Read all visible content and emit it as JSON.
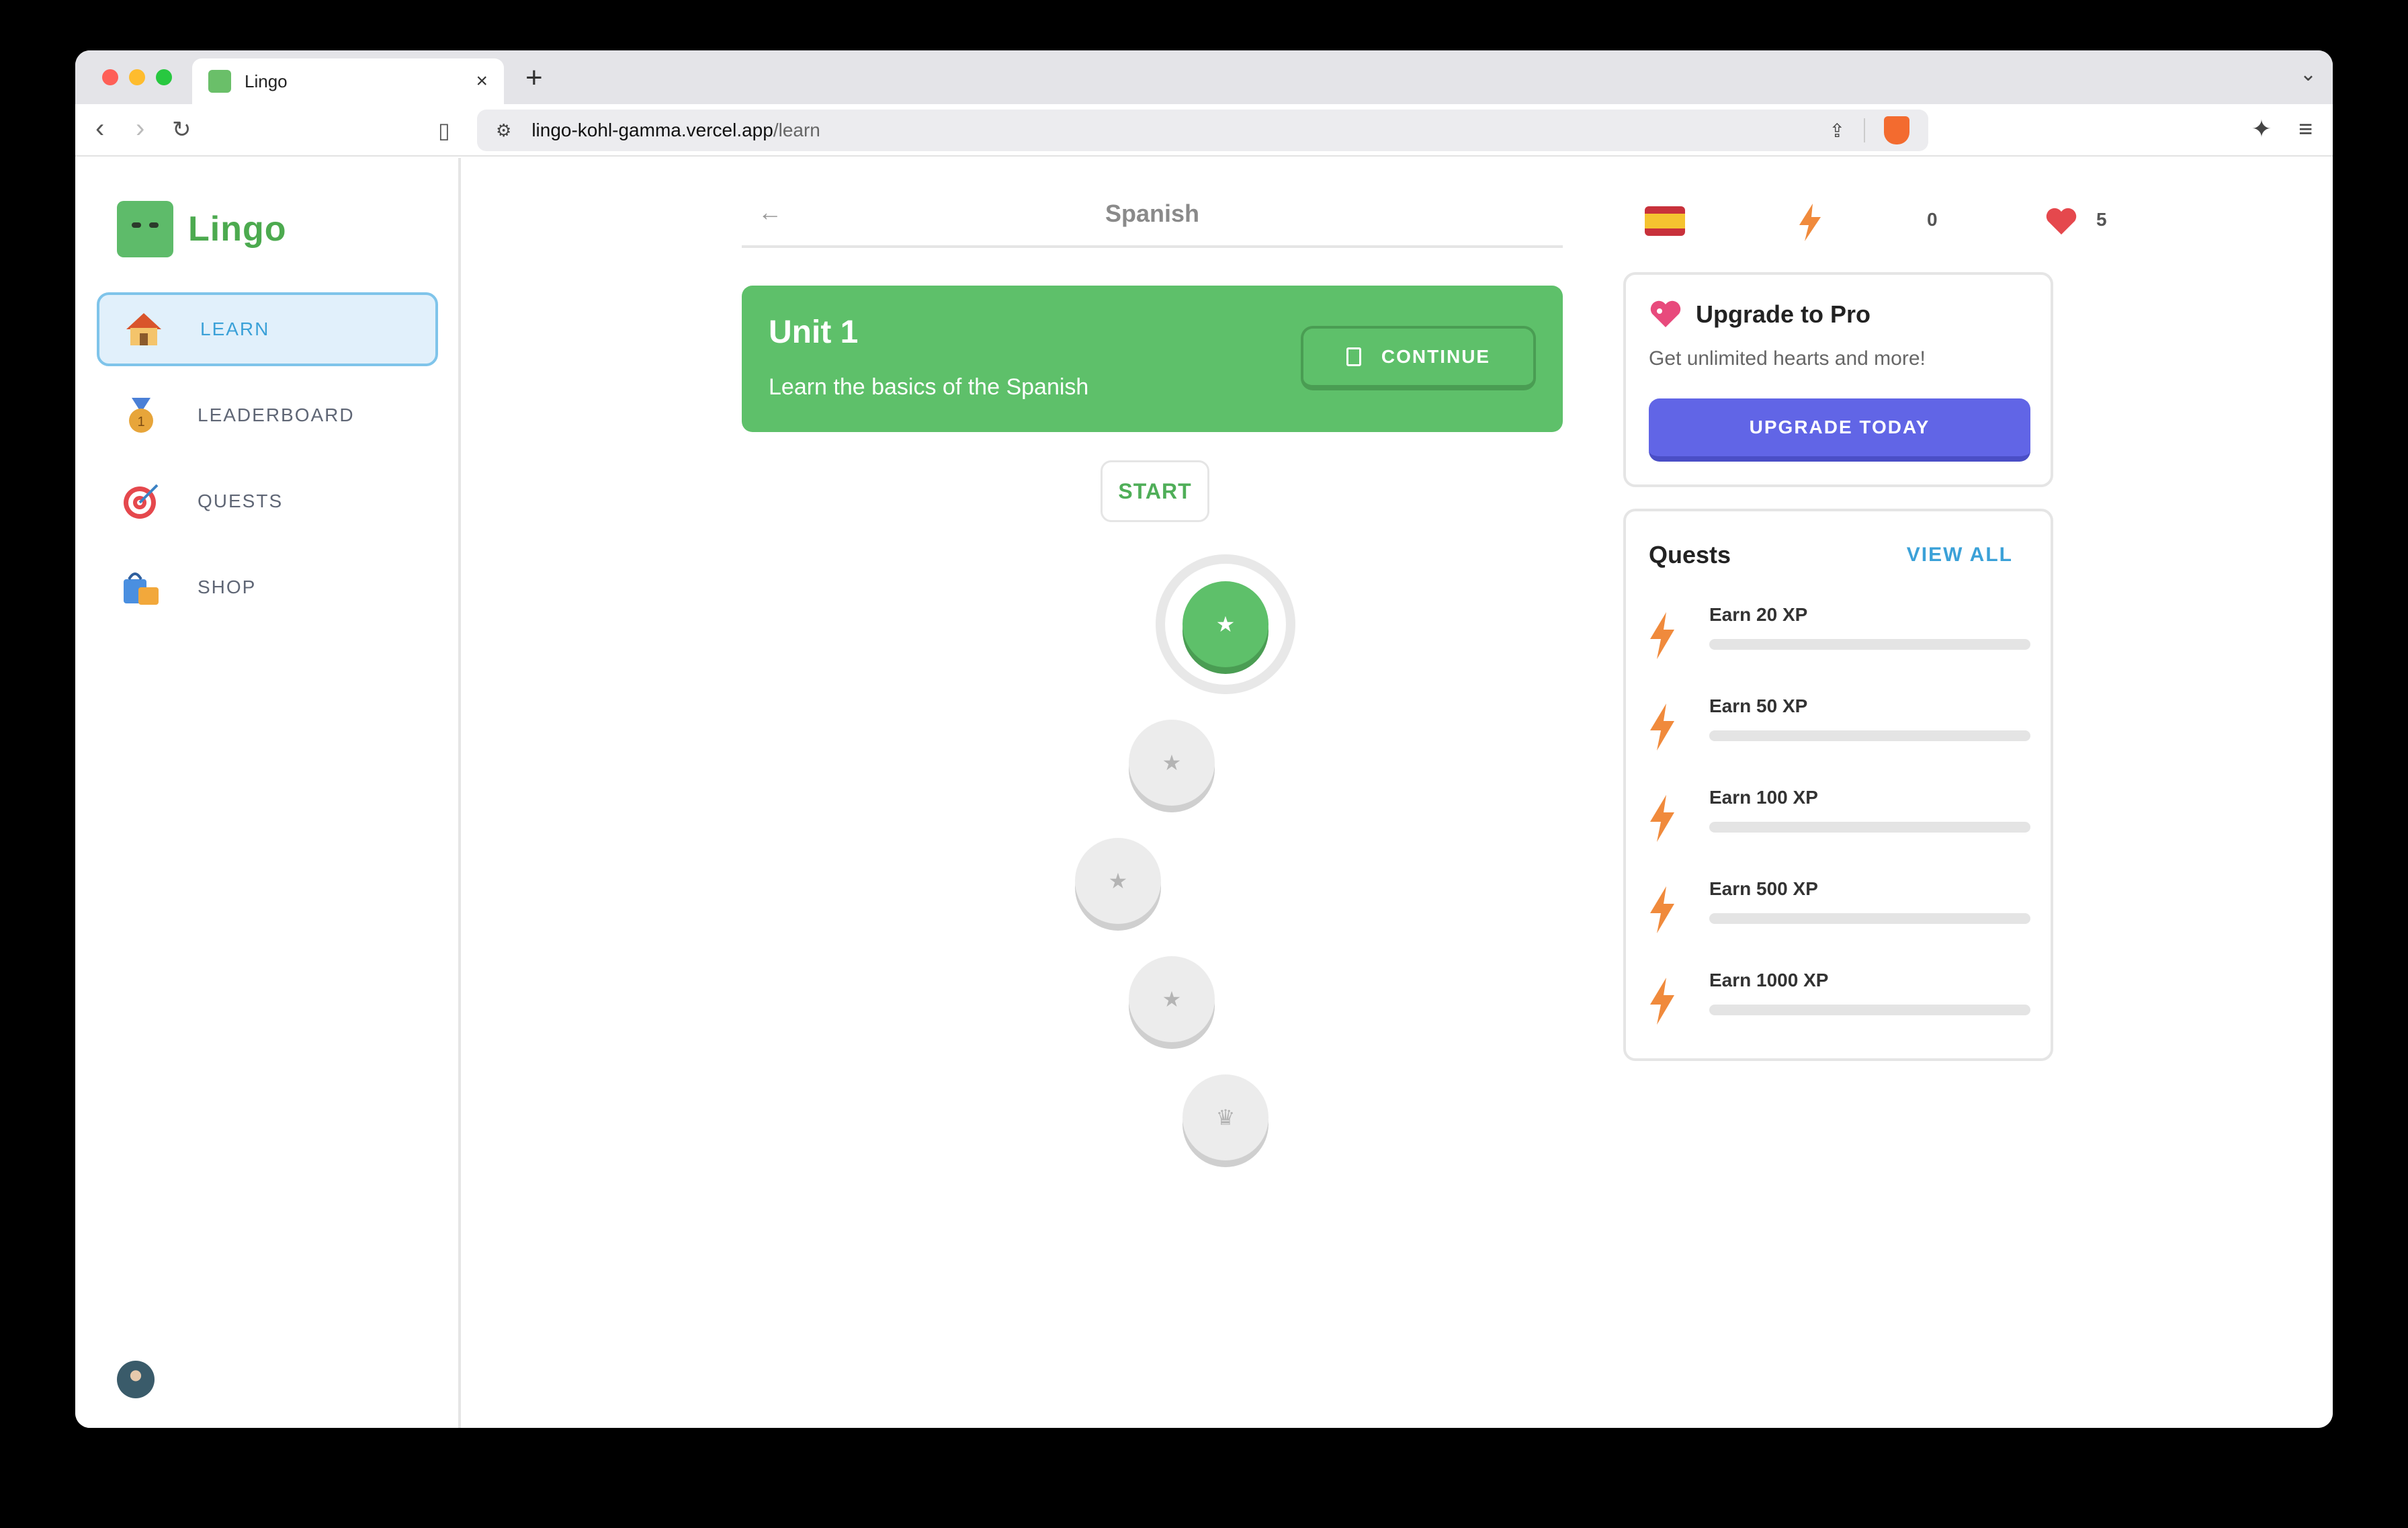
{
  "browser": {
    "tab_title": "Lingo",
    "url_host": "lingo-kohl-gamma.vercel.app",
    "url_path": "/learn"
  },
  "sidebar": {
    "brand": "Lingo",
    "items": [
      {
        "label": "LEARN",
        "icon": "house-icon",
        "active": true
      },
      {
        "label": "LEADERBOARD",
        "icon": "medal-icon",
        "active": false
      },
      {
        "label": "QUESTS",
        "icon": "target-icon",
        "active": false
      },
      {
        "label": "SHOP",
        "icon": "shopping-bag-icon",
        "active": false
      }
    ]
  },
  "header": {
    "course_title": "Spanish"
  },
  "unit": {
    "title": "Unit 1",
    "description": "Learn the basics of the Spanish",
    "continue_label": "CONTINUE"
  },
  "path": {
    "start_label": "START"
  },
  "stats": {
    "points": "0",
    "hearts": "5"
  },
  "pro_card": {
    "title": "Upgrade to Pro",
    "subtitle": "Get unlimited hearts and more!",
    "button_label": "UPGRADE TODAY"
  },
  "quests_card": {
    "title": "Quests",
    "view_all_label": "VIEW ALL",
    "items": [
      {
        "label": "Earn 20 XP",
        "progress": 0
      },
      {
        "label": "Earn 50 XP",
        "progress": 0
      },
      {
        "label": "Earn 100 XP",
        "progress": 0
      },
      {
        "label": "Earn 500 XP",
        "progress": 0
      },
      {
        "label": "Earn 1000 XP",
        "progress": 0
      }
    ]
  },
  "colors": {
    "brand_green": "#5ec06a",
    "accent_blue": "#3ba1d8",
    "pro_purple": "#6165e6"
  }
}
